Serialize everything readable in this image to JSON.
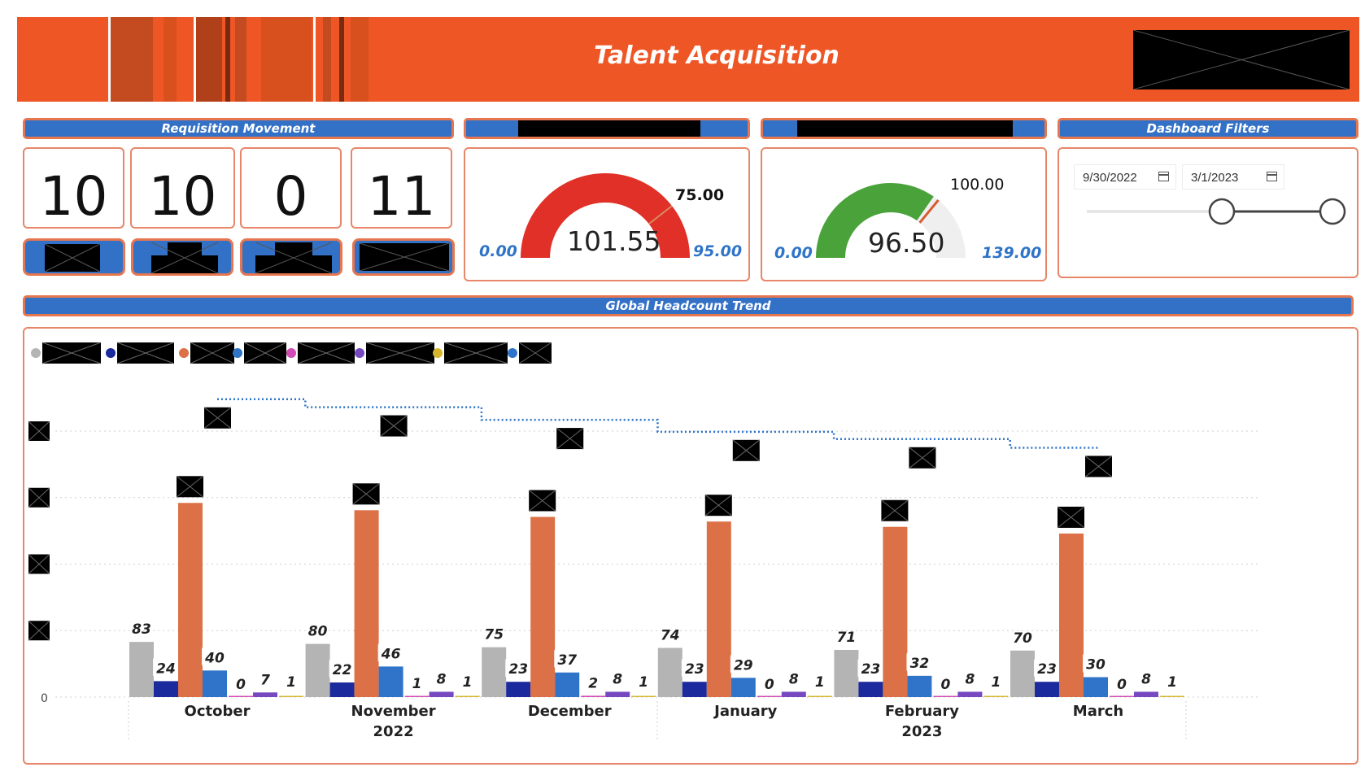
{
  "header": {
    "title": "Talent Acquisition",
    "brand_color": "#ee5626"
  },
  "requisition": {
    "title": "Requisition Movement",
    "values": [
      "10",
      "10",
      "0",
      "11"
    ]
  },
  "gauge1": {
    "min": "0.00",
    "max": "95.00",
    "value": "101.55",
    "target": "75.00",
    "color": "#e03027"
  },
  "gauge2": {
    "min": "0.00",
    "max": "139.00",
    "value": "96.50",
    "target": "100.00",
    "color": "#4aa33a"
  },
  "filters": {
    "title": "Dashboard Filters",
    "start_date": "9/30/2022",
    "end_date": "3/1/2023",
    "slider_start": 0,
    "slider_end": 1
  },
  "trend": {
    "title": "Global Headcount Trend"
  },
  "chart_data": {
    "type": "bar",
    "zero_label": "0",
    "categories": [
      "October",
      "November",
      "December",
      "January",
      "February",
      "March"
    ],
    "year_labels": [
      "2022",
      "2023"
    ],
    "series_colors": [
      "#b4b4b4",
      "#1b2a9c",
      "#dc7046",
      "#2f74c8",
      "#d24bb5",
      "#7649c0",
      "#d6b52c"
    ],
    "bar_series": [
      {
        "color": "#b4b4b4",
        "values": [
          83,
          80,
          75,
          74,
          71,
          70
        ]
      },
      {
        "color": "#1b2a9c",
        "values": [
          24,
          22,
          23,
          23,
          23,
          23
        ]
      },
      {
        "color": "#dc7046",
        "values": [
          292,
          281,
          271,
          264,
          256,
          246
        ]
      },
      {
        "color": "#2f74c8",
        "values": [
          40,
          46,
          37,
          29,
          32,
          30
        ]
      },
      {
        "color": "#d24bb5",
        "values": [
          0,
          1,
          2,
          0,
          0,
          0
        ]
      },
      {
        "color": "#7649c0",
        "values": [
          7,
          8,
          8,
          8,
          8,
          8
        ]
      },
      {
        "color": "#d6b52c",
        "values": [
          1,
          1,
          1,
          1,
          1,
          1
        ]
      }
    ],
    "line_series": {
      "color": "#2f74c8",
      "style": "dotted-step",
      "values": [
        448,
        436,
        417,
        399,
        388,
        375
      ]
    },
    "ylim": [
      0,
      450
    ],
    "grid": true
  }
}
